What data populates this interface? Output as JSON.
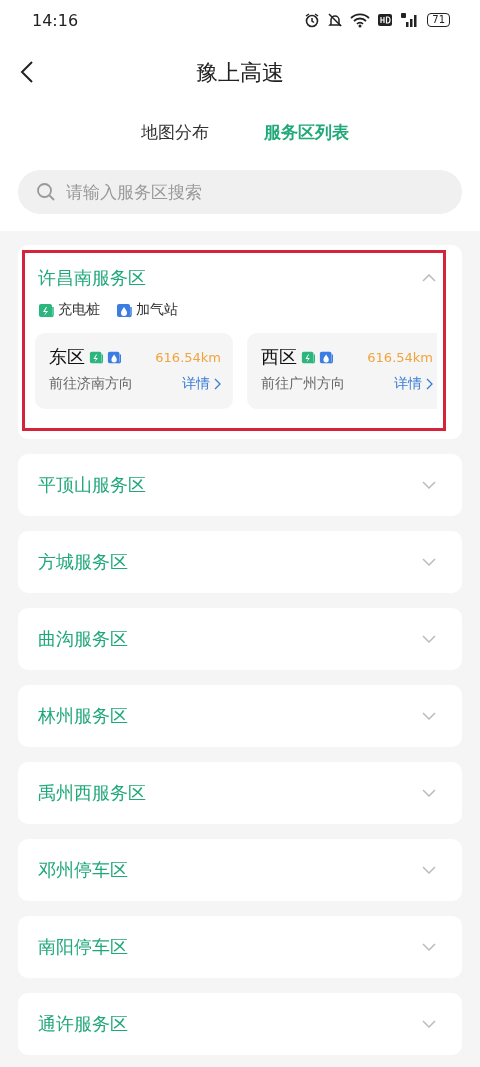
{
  "status_bar": {
    "time": "14:16",
    "battery": "71"
  },
  "header": {
    "title": "豫上高速"
  },
  "tabs": [
    {
      "label": "地图分布",
      "selected": false
    },
    {
      "label": "服务区列表",
      "selected": true
    }
  ],
  "search": {
    "placeholder": "请输入服务区搜索"
  },
  "service_areas": [
    {
      "name": "许昌南服务区",
      "expanded": true,
      "highlighted": true,
      "facilities": [
        {
          "kind": "charging",
          "label": "充电桩"
        },
        {
          "kind": "gas",
          "label": "加气站"
        }
      ],
      "zones": [
        {
          "name": "东区",
          "facilities": [
            {
              "kind": "charging"
            },
            {
              "kind": "gas"
            }
          ],
          "distance": "616.54km",
          "direction": "前往济南方向",
          "link": "详情"
        },
        {
          "name": "西区",
          "facilities": [
            {
              "kind": "charging"
            },
            {
              "kind": "gas"
            }
          ],
          "distance": "616.54km",
          "direction": "前往广州方向",
          "link": "详情"
        }
      ]
    },
    {
      "name": "平顶山服务区",
      "expanded": false,
      "highlighted": false
    },
    {
      "name": "方城服务区",
      "expanded": false,
      "highlighted": false
    },
    {
      "name": "曲沟服务区",
      "expanded": false,
      "highlighted": false
    },
    {
      "name": "林州服务区",
      "expanded": false,
      "highlighted": false
    },
    {
      "name": "禹州西服务区",
      "expanded": false,
      "highlighted": false
    },
    {
      "name": "邓州停车区",
      "expanded": false,
      "highlighted": false
    },
    {
      "name": "南阳停车区",
      "expanded": false,
      "highlighted": false
    },
    {
      "name": "通许服务区",
      "expanded": false,
      "highlighted": false
    }
  ]
}
